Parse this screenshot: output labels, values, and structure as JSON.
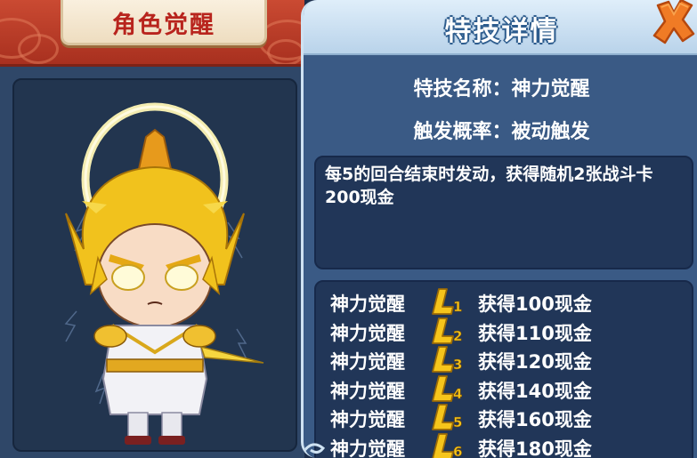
{
  "left_panel": {
    "title": "角色觉醒"
  },
  "right_panel": {
    "title": "特技详情",
    "skill_name_label": "特技名称：",
    "skill_name": "神力觉醒",
    "trigger_label": "触发概率：",
    "trigger_value": "被动触发",
    "description": "每5的回合结束时发动，获得随机2张战斗卡200现金",
    "levels": [
      {
        "name": "神力觉醒",
        "level": "1",
        "reward": "获得100现金"
      },
      {
        "name": "神力觉醒",
        "level": "2",
        "reward": "获得110现金"
      },
      {
        "name": "神力觉醒",
        "level": "3",
        "reward": "获得120现金"
      },
      {
        "name": "神力觉醒",
        "level": "4",
        "reward": "获得140现金"
      },
      {
        "name": "神力觉醒",
        "level": "5",
        "reward": "获得160现金"
      },
      {
        "name": "神力觉醒",
        "level": "6",
        "reward": "获得180现金"
      }
    ]
  },
  "icons": {
    "close": "close-x-icon",
    "level_badge": "level-l-icon",
    "character": "awakened-hero-portrait"
  },
  "colors": {
    "left_header": "#b8321f",
    "right_header": "#cfe3f5",
    "panel_blue": "#3a5a85",
    "badge_gold": "#f6c51b",
    "close_orange": "#f07b25"
  }
}
